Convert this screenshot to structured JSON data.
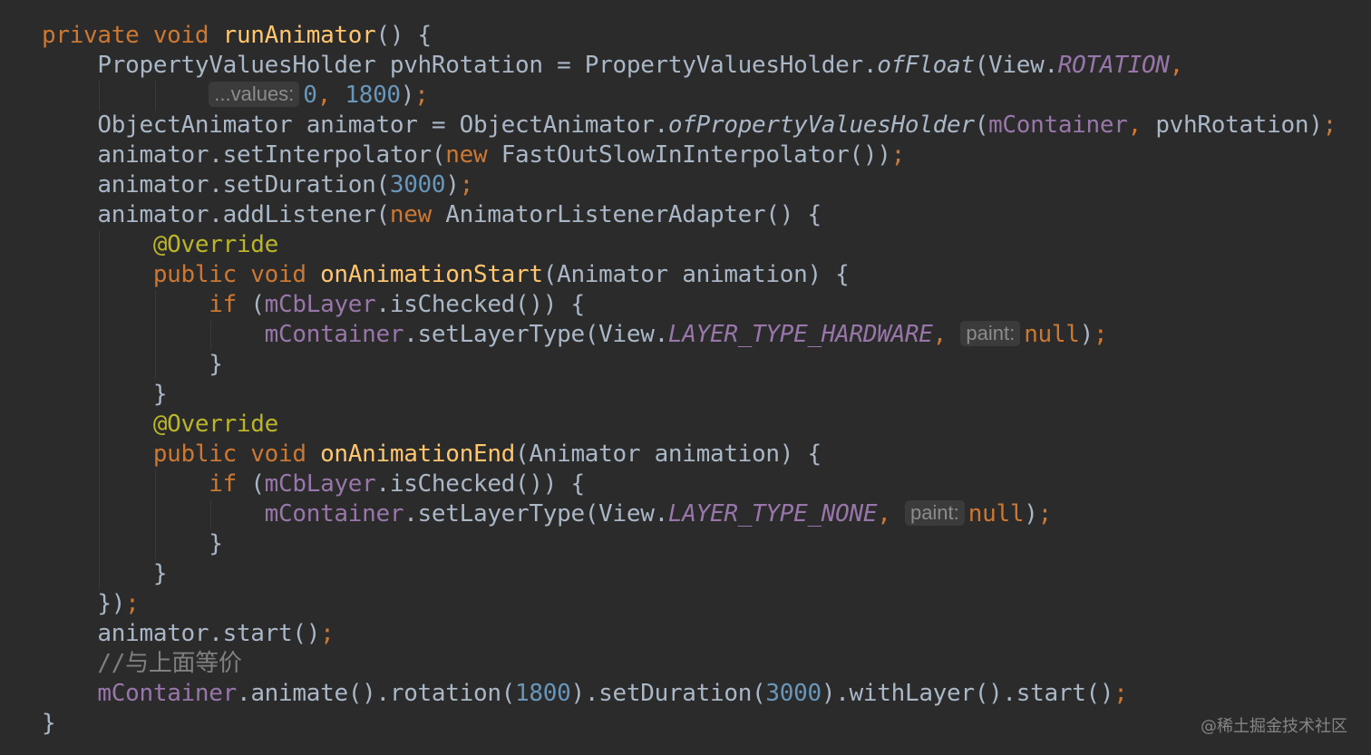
{
  "editor": {
    "theme_colors": {
      "background": "#2b2b2b",
      "keyword": "#cc7832",
      "method_declaration": "#ffc66d",
      "plain_text": "#a9b7c6",
      "field": "#9876aa",
      "number": "#6897bb",
      "annotation": "#bbb529",
      "comment": "#808080",
      "inlay_hint": "#8c8c8c"
    },
    "lines": [
      {
        "indent": 0,
        "tokens": [
          {
            "t": "private void ",
            "c": "kw"
          },
          {
            "t": "runAnimator",
            "c": "fn"
          },
          {
            "t": "() {",
            "c": "txt"
          }
        ]
      },
      {
        "indent": 1,
        "tokens": [
          {
            "t": "PropertyValuesHolder pvhRotation = PropertyValuesHolder.",
            "c": "txt"
          },
          {
            "t": "ofFloat",
            "c": "sm"
          },
          {
            "t": "(View.",
            "c": "txt"
          },
          {
            "t": "ROTATION",
            "c": "sfi"
          },
          {
            "t": ",",
            "c": "kw"
          }
        ]
      },
      {
        "indent": 3,
        "tokens": [
          {
            "t": "...values:",
            "c": "hint"
          },
          {
            "t": "0",
            "c": "num"
          },
          {
            "t": ", ",
            "c": "kw"
          },
          {
            "t": "1800",
            "c": "num"
          },
          {
            "t": ")",
            "c": "txt"
          },
          {
            "t": ";",
            "c": "kw"
          }
        ]
      },
      {
        "indent": 1,
        "tokens": [
          {
            "t": "ObjectAnimator animator = ObjectAnimator.",
            "c": "txt"
          },
          {
            "t": "ofPropertyValuesHolder",
            "c": "sm"
          },
          {
            "t": "(",
            "c": "txt"
          },
          {
            "t": "mContainer",
            "c": "fld"
          },
          {
            "t": ", ",
            "c": "kw"
          },
          {
            "t": "pvhRotation)",
            "c": "txt"
          },
          {
            "t": ";",
            "c": "kw"
          }
        ]
      },
      {
        "indent": 1,
        "tokens": [
          {
            "t": "animator.setInterpolator(",
            "c": "txt"
          },
          {
            "t": "new ",
            "c": "kw"
          },
          {
            "t": "FastOutSlowInInterpolator())",
            "c": "txt"
          },
          {
            "t": ";",
            "c": "kw"
          }
        ]
      },
      {
        "indent": 1,
        "tokens": [
          {
            "t": "animator.setDuration(",
            "c": "txt"
          },
          {
            "t": "3000",
            "c": "num"
          },
          {
            "t": ")",
            "c": "txt"
          },
          {
            "t": ";",
            "c": "kw"
          }
        ]
      },
      {
        "indent": 1,
        "tokens": [
          {
            "t": "animator.addListener(",
            "c": "txt"
          },
          {
            "t": "new ",
            "c": "kw"
          },
          {
            "t": "AnimatorListenerAdapter() {",
            "c": "txt"
          }
        ]
      },
      {
        "indent": 2,
        "tokens": [
          {
            "t": "@Override",
            "c": "ann"
          }
        ]
      },
      {
        "indent": 2,
        "tokens": [
          {
            "t": "public void ",
            "c": "kw"
          },
          {
            "t": "onAnimationStart",
            "c": "fn"
          },
          {
            "t": "(Animator animation) {",
            "c": "txt"
          }
        ]
      },
      {
        "indent": 3,
        "tokens": [
          {
            "t": "if ",
            "c": "kw"
          },
          {
            "t": "(",
            "c": "txt"
          },
          {
            "t": "mCbLayer",
            "c": "fld"
          },
          {
            "t": ".isChecked()) {",
            "c": "txt"
          }
        ]
      },
      {
        "indent": 4,
        "tokens": [
          {
            "t": "mContainer",
            "c": "fld"
          },
          {
            "t": ".setLayerType(View.",
            "c": "txt"
          },
          {
            "t": "LAYER_TYPE_HARDWARE",
            "c": "sfi"
          },
          {
            "t": ", ",
            "c": "kw"
          },
          {
            "t": "paint:",
            "c": "hint"
          },
          {
            "t": "null",
            "c": "kw"
          },
          {
            "t": ")",
            "c": "txt"
          },
          {
            "t": ";",
            "c": "kw"
          }
        ]
      },
      {
        "indent": 3,
        "tokens": [
          {
            "t": "}",
            "c": "txt"
          }
        ]
      },
      {
        "indent": 2,
        "tokens": [
          {
            "t": "}",
            "c": "txt"
          }
        ]
      },
      {
        "indent": 2,
        "tokens": [
          {
            "t": "@Override",
            "c": "ann"
          }
        ]
      },
      {
        "indent": 2,
        "tokens": [
          {
            "t": "public void ",
            "c": "kw"
          },
          {
            "t": "onAnimationEnd",
            "c": "fn"
          },
          {
            "t": "(Animator animation) {",
            "c": "txt"
          }
        ]
      },
      {
        "indent": 3,
        "tokens": [
          {
            "t": "if ",
            "c": "kw"
          },
          {
            "t": "(",
            "c": "txt"
          },
          {
            "t": "mCbLayer",
            "c": "fld"
          },
          {
            "t": ".isChecked()) {",
            "c": "txt"
          }
        ]
      },
      {
        "indent": 4,
        "tokens": [
          {
            "t": "mContainer",
            "c": "fld"
          },
          {
            "t": ".setLayerType(View.",
            "c": "txt"
          },
          {
            "t": "LAYER_TYPE_NONE",
            "c": "sfi"
          },
          {
            "t": ", ",
            "c": "kw"
          },
          {
            "t": "paint:",
            "c": "hint"
          },
          {
            "t": "null",
            "c": "kw"
          },
          {
            "t": ")",
            "c": "txt"
          },
          {
            "t": ";",
            "c": "kw"
          }
        ]
      },
      {
        "indent": 3,
        "tokens": [
          {
            "t": "}",
            "c": "txt"
          }
        ]
      },
      {
        "indent": 2,
        "tokens": [
          {
            "t": "}",
            "c": "txt"
          }
        ]
      },
      {
        "indent": 1,
        "tokens": [
          {
            "t": "})",
            "c": "txt"
          },
          {
            "t": ";",
            "c": "kw"
          }
        ]
      },
      {
        "indent": 1,
        "tokens": [
          {
            "t": "animator.start()",
            "c": "txt"
          },
          {
            "t": ";",
            "c": "kw"
          }
        ]
      },
      {
        "indent": 1,
        "tokens": [
          {
            "t": "//与上面等价",
            "c": "cmt"
          }
        ]
      },
      {
        "indent": 1,
        "tokens": [
          {
            "t": "mContainer",
            "c": "fld"
          },
          {
            "t": ".animate().rotation(",
            "c": "txt"
          },
          {
            "t": "1800",
            "c": "num"
          },
          {
            "t": ").setDuration(",
            "c": "txt"
          },
          {
            "t": "3000",
            "c": "num"
          },
          {
            "t": ").withLayer().start()",
            "c": "txt"
          },
          {
            "t": ";",
            "c": "kw"
          }
        ]
      },
      {
        "indent": 0,
        "tokens": [
          {
            "t": "}",
            "c": "txt"
          }
        ]
      }
    ]
  },
  "watermark": "@稀土掘金技术社区"
}
